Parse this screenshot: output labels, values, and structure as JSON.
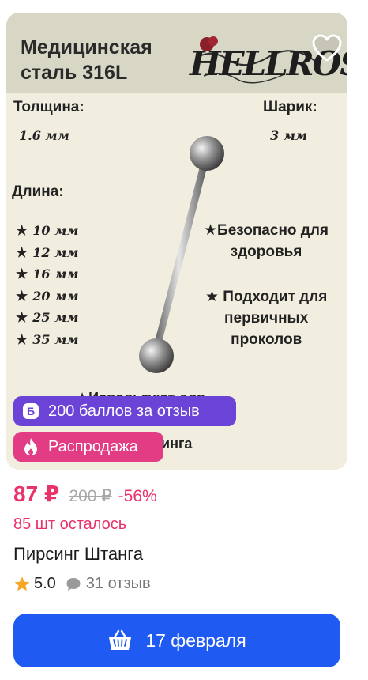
{
  "photo": {
    "title": "Медицинская\nсталь 316L",
    "brand": "HELLROSE",
    "thickness_label": "Толщина:",
    "thickness_value": "1.6 мм",
    "ball_label": "Шарик:",
    "ball_value": "3 мм",
    "length_label": "Длина:",
    "lengths": [
      "10 мм",
      "12 мм",
      "16 мм",
      "20 мм",
      "25 мм",
      "35 мм"
    ],
    "feature_safe": "★Безопасно для\nздоровья",
    "feature_primary": "★ Подходит для\nпервичных\nпроколов",
    "feature_hidden_top": "★Используют для",
    "feature_hidden_bottom": "инга"
  },
  "badges": {
    "points": "200 баллов за отзыв",
    "sale": "Распродажа"
  },
  "price": {
    "current": "87 ₽",
    "old": "200 ₽",
    "discount": "-56%"
  },
  "stock": "85 шт осталось",
  "product_name": "Пирсинг Штанга",
  "rating": {
    "score": "5.0",
    "reviews": "31 отзыв"
  },
  "delivery_button": "17 февраля",
  "colors": {
    "accent_pink": "#e8326a",
    "points_purple": "#6b43d6",
    "sale_pink": "#e23d84",
    "button_blue": "#1f5af2",
    "star_gold": "#f5a623"
  },
  "icons": [
    "heart-icon",
    "points-icon",
    "fire-icon",
    "star-icon",
    "chat-icon",
    "basket-icon"
  ]
}
